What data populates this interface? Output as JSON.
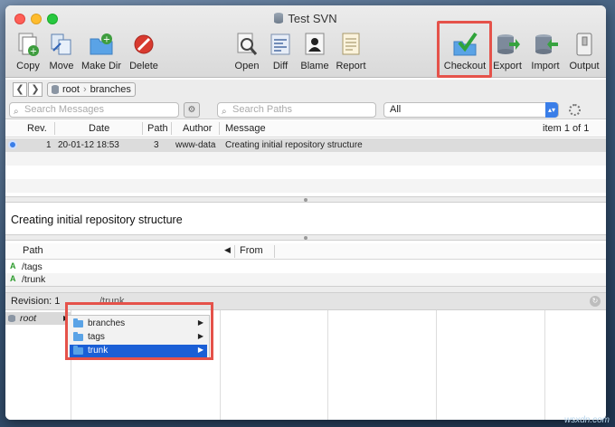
{
  "window": {
    "title": "Test SVN"
  },
  "toolbar": {
    "copy": "Copy",
    "move": "Move",
    "make_dir": "Make Dir",
    "delete": "Delete",
    "open": "Open",
    "diff": "Diff",
    "blame": "Blame",
    "report": "Report",
    "checkout": "Checkout",
    "export": "Export",
    "import": "Import",
    "output": "Output"
  },
  "nav": {
    "back": "❮",
    "forward": "❯",
    "crumbs": [
      "root",
      "branches"
    ]
  },
  "search": {
    "messages_placeholder": "Search Messages",
    "paths_placeholder": "Search Paths",
    "filter": "All"
  },
  "log_table": {
    "headers": {
      "rev": "Rev.",
      "date": "Date",
      "path": "Path",
      "author": "Author",
      "message": "Message"
    },
    "pager": "item 1 of 1",
    "rows": [
      {
        "rev": "1",
        "date": "20-01-12 18:53",
        "path": "3",
        "author": "www-data",
        "message": "Creating initial repository structure"
      }
    ]
  },
  "message_detail": "Creating initial repository structure",
  "paths_table": {
    "headers": {
      "path": "Path",
      "from": "From"
    },
    "rows": [
      {
        "action": "A",
        "path": "/tags"
      },
      {
        "action": "A",
        "path": "/trunk"
      }
    ]
  },
  "revision_bar": {
    "label": "Revision: 1",
    "path": "/trunk"
  },
  "browser": {
    "root": "root",
    "items": [
      {
        "label": "branches"
      },
      {
        "label": "tags"
      },
      {
        "label": "trunk"
      }
    ]
  },
  "watermark": "wsxdn.com",
  "colors": {
    "highlight": "#e5524a",
    "selection": "#1b5fd6",
    "accent": "#3a7ee8"
  }
}
